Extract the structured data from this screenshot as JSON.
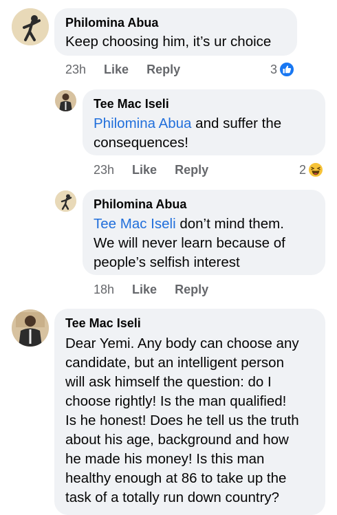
{
  "comments": [
    {
      "author": "Philomina Abua",
      "text": "Keep choosing him, it’s ur choice",
      "time": "23h",
      "like_label": "Like",
      "reply_label": "Reply",
      "reaction_count": "3",
      "reaction_icon": "like-reaction-icon"
    },
    {
      "author": "Tee Mac Iseli",
      "mention": "Philomina Abua",
      "text_line1_rest": " and suffer the",
      "text_line2": "consequences!",
      "time": "23h",
      "like_label": "Like",
      "reply_label": "Reply",
      "reaction_count": "2",
      "reaction_icon": "haha-reaction-icon"
    },
    {
      "author": "Philomina Abua",
      "mention": "Tee Mac Iseli",
      "text_line1_rest": " don’t mind them.",
      "text_line2": "We will never learn because of",
      "text_line3": "people’s selfish interest",
      "time": "18h",
      "like_label": "Like",
      "reply_label": "Reply"
    },
    {
      "author": "Tee Mac Iseli",
      "lines": [
        "Dear Yemi. Any body can choose any",
        "candidate, but an intelligent person",
        "will ask himself the question: do I",
        "choose rightly! Is the man qualified!",
        "Is he honest! Does he tell us the truth",
        "about his age, background and how",
        "he made his money! Is this man",
        "healthy enough at 86 to take up the",
        "task of a totally run down country?"
      ]
    }
  ],
  "colors": {
    "bubble": "#f0f2f5",
    "mention": "#216fdb",
    "meta": "#65676b",
    "like_blue": "#1877f2"
  }
}
